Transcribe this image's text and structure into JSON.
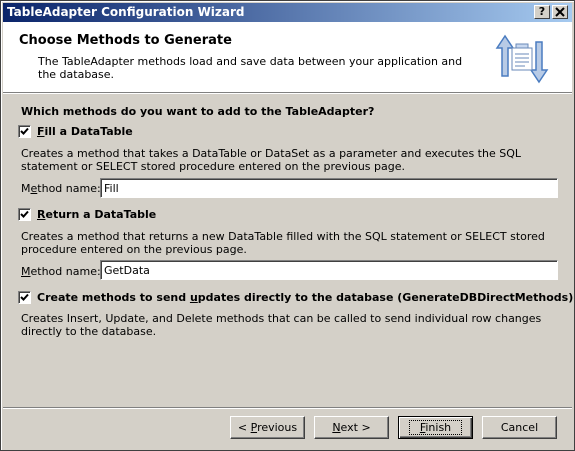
{
  "window": {
    "title": "TableAdapter Configuration Wizard",
    "help_button": "?",
    "close_button": "X"
  },
  "header": {
    "title": "Choose Methods to Generate",
    "description": "The TableAdapter methods load and save data between your application and the database."
  },
  "question": "Which methods do you want to add to the TableAdapter?",
  "options": [
    {
      "label_pre": "",
      "label_ul": "F",
      "label_post": "ill a DataTable",
      "checked": true,
      "description": "Creates a method that takes a DataTable or DataSet as a parameter and executes the SQL statement or SELECT stored procedure entered on the previous page.",
      "method_label_pre": "M",
      "method_label_ul": "e",
      "method_label_post": "thod name:",
      "method_value": "Fill"
    },
    {
      "label_pre": "",
      "label_ul": "R",
      "label_post": "eturn a DataTable",
      "checked": true,
      "description": "Creates a method that returns a new DataTable filled with the SQL statement or SELECT stored procedure entered on the previous page.",
      "method_label_pre": "",
      "method_label_ul": "M",
      "method_label_post": "ethod name:",
      "method_value": "GetData"
    },
    {
      "label_pre": "Create methods to send ",
      "label_ul": "u",
      "label_post": "pdates directly to the database (GenerateDBDirectMethods)",
      "checked": true,
      "description": "Creates Insert, Update, and Delete methods that can be called to send individual row changes directly to the database."
    }
  ],
  "buttons": {
    "previous_pre": "< ",
    "previous_ul": "P",
    "previous_post": "revious",
    "next_ul": "N",
    "next_post": "ext >",
    "finish_ul": "F",
    "finish_post": "inish",
    "cancel": "Cancel"
  },
  "colors": {
    "title_bar_start": "#0a246a",
    "title_bar_end": "#a6caf0",
    "dialog_face": "#d4d0c8",
    "icon_blue": "#4a7cc0"
  },
  "icons": {
    "header_icon": "data-transfer-arrows-icon",
    "check": "checkmark-icon"
  }
}
